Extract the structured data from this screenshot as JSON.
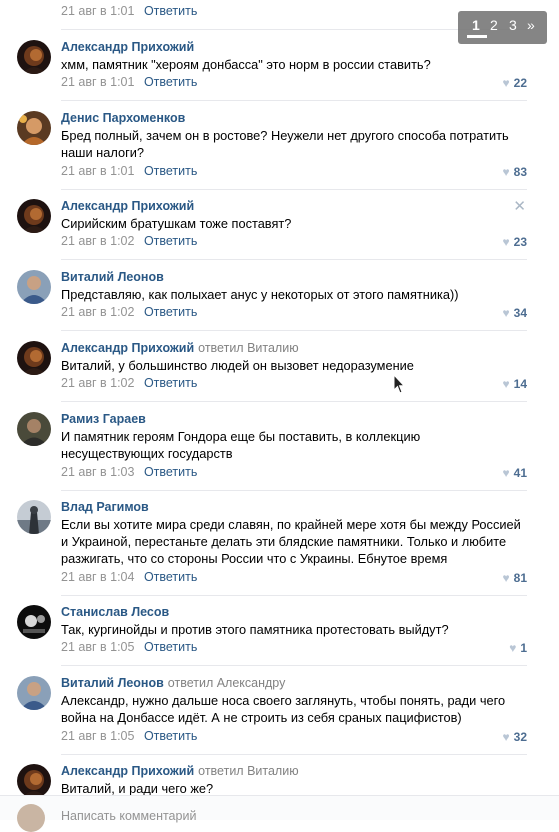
{
  "pager": {
    "pages": [
      "1",
      "2",
      "3"
    ],
    "next": "»"
  },
  "reply_label": "Ответить",
  "composer": {
    "placeholder": "Написать комментарий"
  },
  "comments": [
    {
      "author": "",
      "replied_to": "",
      "text": "",
      "time": "21 авг в 1:01",
      "likes": ""
    },
    {
      "author": "Александр Прихожий",
      "replied_to": "",
      "text": "хмм, памятник \"хероям донбасса\" это норм в россии ставить?",
      "time": "21 авг в 1:01",
      "likes": "22"
    },
    {
      "author": "Денис Пархоменков",
      "replied_to": "",
      "text": "Бред полный, зачем он в ростове? Неужели нет другого способа потратить наши налоги?",
      "time": "21 авг в 1:01",
      "likes": "83"
    },
    {
      "author": "Александр Прихожий",
      "replied_to": "",
      "text": "Сирийским братушкам тоже поставят?",
      "time": "21 авг в 1:02",
      "likes": "23"
    },
    {
      "author": "Виталий Леонов",
      "replied_to": "",
      "text": "Представляю, как полыхает анус у некоторых от этого памятника))",
      "time": "21 авг в 1:02",
      "likes": "34"
    },
    {
      "author": "Александр Прихожий",
      "replied_to": "ответил Виталию",
      "text": "Виталий, у большинство людей он вызовет недоразумение",
      "time": "21 авг в 1:02",
      "likes": "14"
    },
    {
      "author": "Рамиз Гараев",
      "replied_to": "",
      "text": "И памятник героям Гондора еще бы поставить, в коллекцию несуществующих государств",
      "time": "21 авг в 1:03",
      "likes": "41"
    },
    {
      "author": "Влад Рагимов",
      "replied_to": "",
      "text": "Если вы хотите мира среди славян, по крайней мере хотя бы между Россией и Украиной, перестаньте делать эти блядские памятники. Только и любите разжигать, что со стороны России что с Украины. Ебнутое время",
      "time": "21 авг в 1:04",
      "likes": "81"
    },
    {
      "author": "Станислав Лесов",
      "replied_to": "",
      "text": "Так, кургинойды и против этого памятника протестовать выйдут?",
      "time": "21 авг в 1:05",
      "likes": "1"
    },
    {
      "author": "Виталий Леонов",
      "replied_to": "ответил Александру",
      "text": "Александр, нужно дальше носа своего заглянуть, чтобы понять, ради чего война на Донбассе идёт. А не строить из себя сраных пацифистов)",
      "time": "21 авг в 1:05",
      "likes": "32"
    },
    {
      "author": "Александр Прихожий",
      "replied_to": "ответил Виталию",
      "text": "Виталий, и ради чего же?",
      "time": "",
      "likes": ""
    }
  ],
  "colors": {
    "link": "#2a5885",
    "meta": "#939393",
    "separator": "#e7e8ec",
    "like": "#4d6d91"
  }
}
